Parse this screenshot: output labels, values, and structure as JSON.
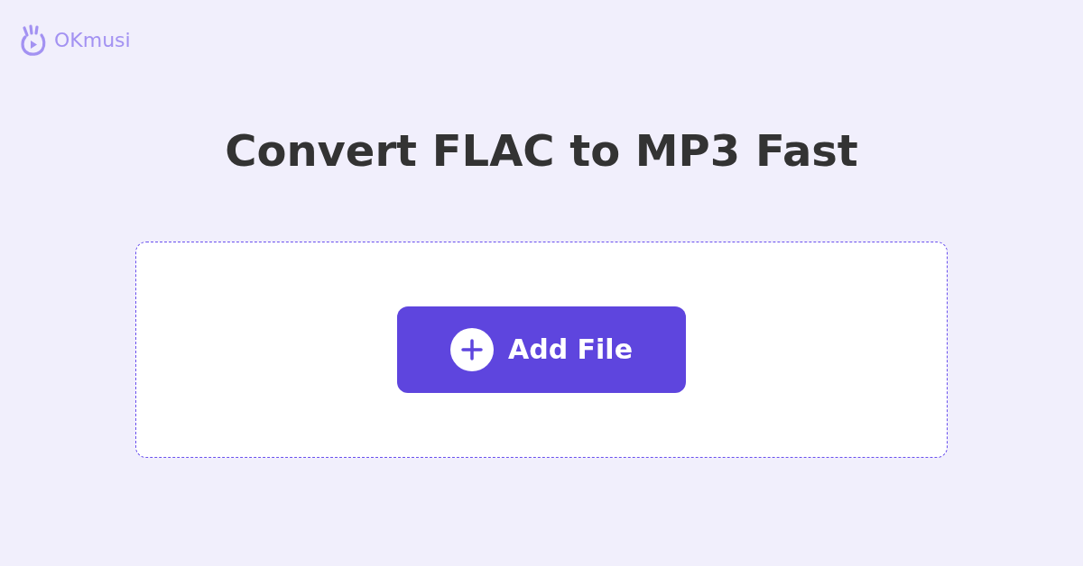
{
  "logo": {
    "text": "OKmusi"
  },
  "headline": "Convert FLAC to MP3 Fast",
  "drop_zone": {
    "button": {
      "label": "Add File"
    }
  }
}
